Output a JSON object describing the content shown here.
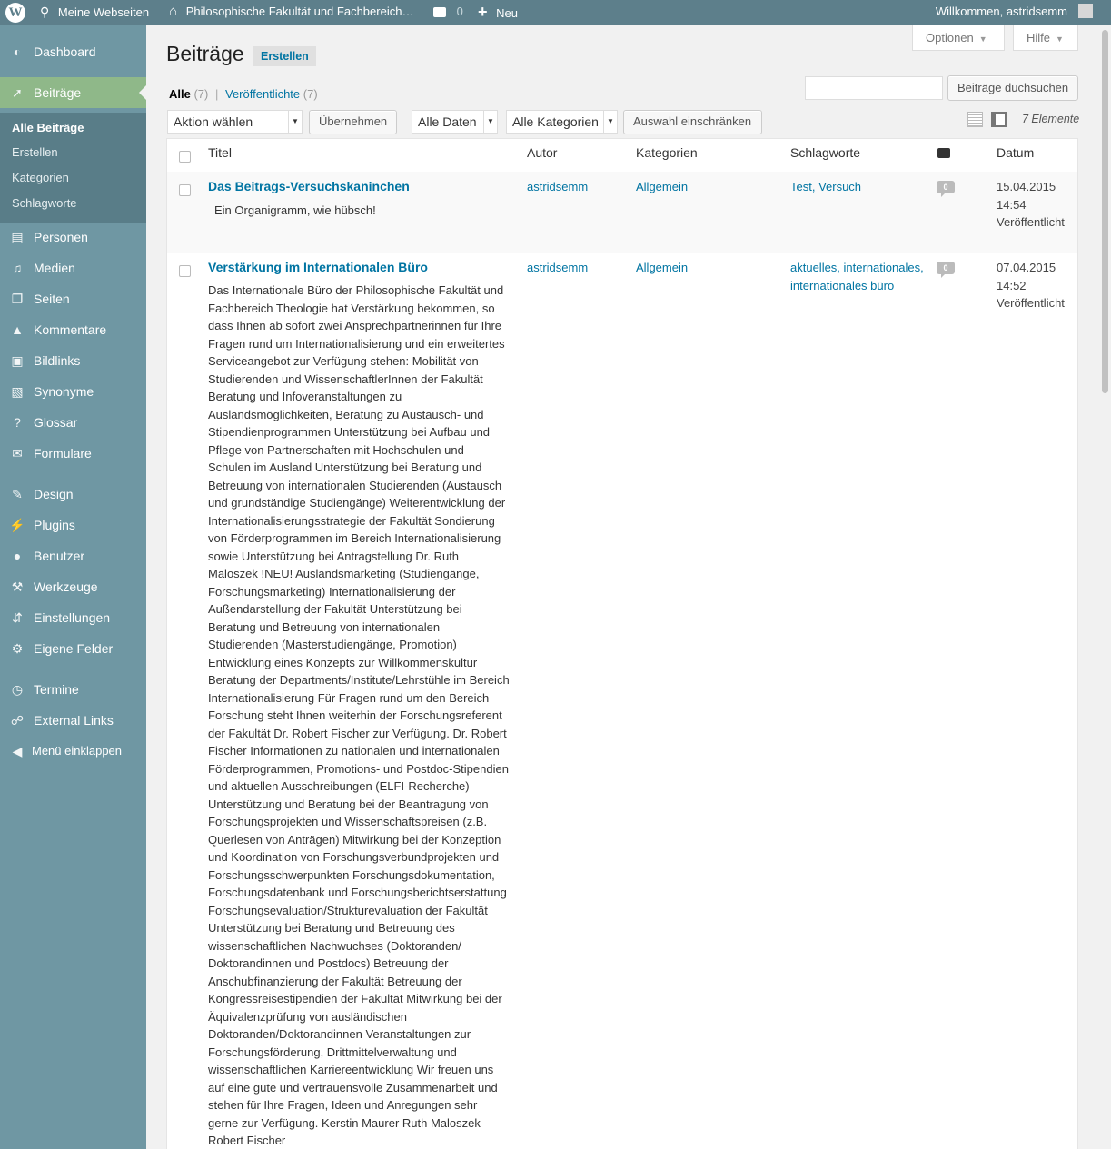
{
  "adminbar": {
    "my_sites": "Meine Webseiten",
    "site_name": "Philosophische Fakultät und Fachbereich…",
    "comments_count": "0",
    "new_label": "Neu",
    "greeting": "Willkommen, astridsemm"
  },
  "sidebar": {
    "items": [
      {
        "label": "Dashboard",
        "icon": "dashboard-icon"
      },
      {
        "label": "Beiträge",
        "icon": "pin-icon"
      },
      {
        "label": "Personen",
        "icon": "id-card-icon"
      },
      {
        "label": "Medien",
        "icon": "media-icon"
      },
      {
        "label": "Seiten",
        "icon": "pages-icon"
      },
      {
        "label": "Kommentare",
        "icon": "comment-icon"
      },
      {
        "label": "Bildlinks",
        "icon": "image-icon"
      },
      {
        "label": "Synonyme",
        "icon": "translation-icon"
      },
      {
        "label": "Glossar",
        "icon": "question-icon"
      },
      {
        "label": "Formulare",
        "icon": "envelope-icon"
      },
      {
        "label": "Design",
        "icon": "brush-icon"
      },
      {
        "label": "Plugins",
        "icon": "plug-icon"
      },
      {
        "label": "Benutzer",
        "icon": "user-icon"
      },
      {
        "label": "Werkzeuge",
        "icon": "wrench-icon"
      },
      {
        "label": "Einstellungen",
        "icon": "sliders-icon"
      },
      {
        "label": "Eigene Felder",
        "icon": "gear-icon"
      },
      {
        "label": "Termine",
        "icon": "clock-icon"
      },
      {
        "label": "External Links",
        "icon": "link-icon"
      },
      {
        "label": "Menü einklappen",
        "icon": "collapse-icon"
      }
    ],
    "submenu": [
      "Alle Beiträge",
      "Erstellen",
      "Kategorien",
      "Schlagworte"
    ]
  },
  "screen_options": {
    "options_label": "Optionen",
    "help_label": "Hilfe"
  },
  "page": {
    "title": "Beiträge",
    "add_new": "Erstellen",
    "filter_all": "Alle",
    "filter_all_count": "(7)",
    "filter_published": "Veröffentlichte",
    "filter_published_count": "(7)",
    "search_placeholder": "",
    "search_button": "Beiträge duchsuchen",
    "bulk_action": "Aktion wählen",
    "apply_button": "Übernehmen",
    "date_filter": "Alle Daten",
    "category_filter": "Alle Kategorien",
    "filter_button": "Auswahl einschränken",
    "items_count": "7 Elemente"
  },
  "table": {
    "columns": {
      "title": "Titel",
      "author": "Autor",
      "categories": "Kategorien",
      "tags": "Schlagworte",
      "date": "Datum"
    },
    "rows": [
      {
        "title": "Das Beitrags-Versuchskaninchen",
        "excerpt": "Ein Organigramm, wie hübsch!",
        "author": "astridsemm",
        "category": "Allgemein",
        "tags": "Test, Versuch",
        "comments": "0",
        "date": "15.04.2015",
        "time": "14:54",
        "status": "Veröffentlicht"
      },
      {
        "title": "Verstärkung im Internationalen Büro",
        "excerpt_lines": [
          "Das Internationale Büro der Philosophische Fakultät und",
          "Fachbereich Theologie hat Verstärkung bekommen, so",
          "dass Ihnen ab sofort zwei Ansprechpartnerinnen für Ihre",
          "Fragen rund um Internationalisierung und ein erweitertes",
          "Serviceangebot zur Verfügung stehen: Mobilität von",
          "Studierenden und WissenschaftlerInnen der Fakultät",
          "Beratung und Infoveranstaltungen zu",
          "Auslandsmöglichkeiten, Beratung zu Austausch- und",
          "Stipendienprogrammen Unterstützung bei Aufbau und",
          "Pflege von Partnerschaften mit Hochschulen und",
          "Schulen im Ausland Unterstützung bei Beratung und",
          "Betreuung von internationalen Studierenden (Austausch",
          "und grundständige Studiengänge) Weiterentwicklung der",
          "Internationalisierungsstrategie der Fakultät Sondierung",
          "von Förderprogrammen im Bereich Internationalisierung",
          "sowie Unterstützung bei Antragstellung Dr. Ruth",
          "Maloszek !NEU! Auslandsmarketing (Studiengänge,",
          "Forschungsmarketing) Internationalisierung der",
          "Außendarstellung der Fakultät Unterstützung bei",
          "Beratung und Betreuung von internationalen",
          "Studierenden (Masterstudiengänge, Promotion)",
          "Entwicklung eines Konzepts zur Willkommenskultur",
          "Beratung der Departments/Institute/Lehrstühle im Bereich",
          "Internationalisierung Für Fragen rund um den Bereich",
          "Forschung steht Ihnen weiterhin der Forschungsreferent",
          "der Fakultät Dr. Robert Fischer zur Verfügung. Dr. Robert",
          "Fischer Informationen zu nationalen und internationalen",
          "Förderprogrammen, Promotions- und Postdoc-Stipendien",
          "und aktuellen Ausschreibungen (ELFI-Recherche)",
          "Unterstützung und Beratung bei der Beantragung von",
          "Forschungsprojekten und Wissenschaftspreisen (z.B.",
          "Querlesen von Anträgen) Mitwirkung bei der Konzeption",
          "und Koordination von Forschungsverbundprojekten und",
          "Forschungsschwerpunkten Forschungsdokumentation,",
          "Forschungsdatenbank und Forschungsberichtserstattung",
          "Forschungsevaluation/Strukturevaluation der Fakultät",
          "Unterstützung bei Beratung und Betreuung des",
          "wissenschaftlichen Nachwuchses (Doktoranden/",
          "Doktorandinnen und Postdocs) Betreuung der",
          "Anschubfinanzierung der Fakultät Betreuung der",
          "Kongressreisestipendien der Fakultät Mitwirkung bei der",
          "Äquivalenzprüfung von ausländischen",
          "Doktoranden/Doktorandinnen Veranstaltungen zur",
          "Forschungsförderung, Drittmittelverwaltung und",
          "wissenschaftlichen Karriereentwicklung Wir freuen uns",
          "auf eine gute und vertrauensvolle Zusammenarbeit und",
          "stehen für Ihre Fragen, Ideen und Anregungen sehr",
          "gerne zur Verfügung. Kerstin Maurer Ruth Maloszek",
          "Robert Fischer"
        ],
        "author": "astridsemm",
        "category": "Allgemein",
        "tags_line1": "aktuelles, internationales,",
        "tags_line2": "internationales büro",
        "comments": "0",
        "date": "07.04.2015",
        "time": "14:52",
        "status": "Veröffentlicht"
      }
    ]
  },
  "colors": {
    "adminbar": "#5d7f8b",
    "sidebar": "#6f97a3",
    "sidebar_current": "#8fb889",
    "link": "#0074a2"
  }
}
